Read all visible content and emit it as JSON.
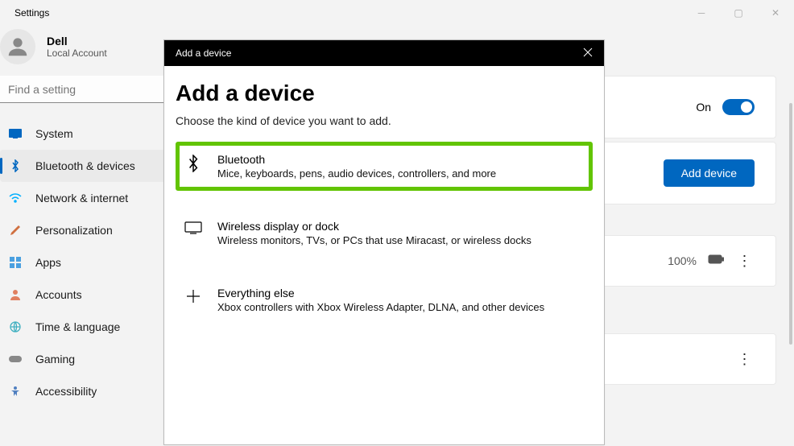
{
  "window": {
    "title": "Settings"
  },
  "account": {
    "name": "Dell",
    "sub": "Local Account"
  },
  "search": {
    "placeholder": "Find a setting"
  },
  "nav": [
    {
      "label": "System",
      "color": "#0067c0"
    },
    {
      "label": "Bluetooth & devices",
      "color": "#0067c0"
    },
    {
      "label": "Network & internet",
      "color": "#00b0ff"
    },
    {
      "label": "Personalization",
      "color": "#d07040"
    },
    {
      "label": "Apps",
      "color": "#4aa0e0"
    },
    {
      "label": "Accounts",
      "color": "#e08060"
    },
    {
      "label": "Time & language",
      "color": "#40b0c0"
    },
    {
      "label": "Gaming",
      "color": "#888"
    },
    {
      "label": "Accessibility",
      "color": "#5080c0"
    }
  ],
  "bt_card": {
    "state": "On",
    "button": "Add device",
    "battery": "100%"
  },
  "modal": {
    "header": "Add a device",
    "title": "Add a device",
    "subtitle": "Choose the kind of device you want to add.",
    "options": [
      {
        "title": "Bluetooth",
        "sub": "Mice, keyboards, pens, audio devices, controllers, and more"
      },
      {
        "title": "Wireless display or dock",
        "sub": "Wireless monitors, TVs, or PCs that use Miracast, or wireless docks"
      },
      {
        "title": "Everything else",
        "sub": "Xbox controllers with Xbox Wireless Adapter, DLNA, and other devices"
      }
    ]
  }
}
